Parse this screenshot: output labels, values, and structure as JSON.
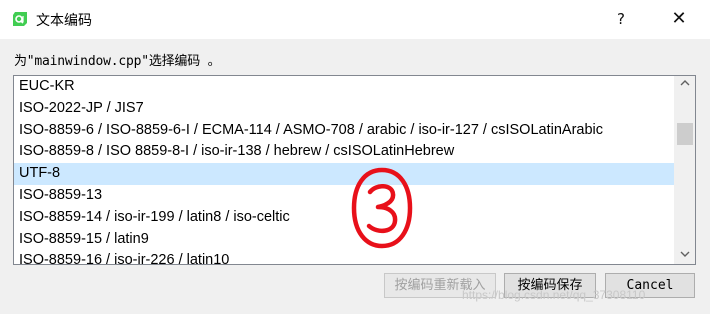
{
  "window": {
    "title": "文本编码",
    "help_label": "?",
    "close_label": "✕",
    "icon": "qt-logo-icon"
  },
  "prompt": "为\"mainwindow.cpp\"选择编码 。",
  "encodings": [
    "EUC-KR",
    "ISO-2022-JP / JIS7",
    "ISO-8859-6 / ISO-8859-6-I / ECMA-114 / ASMO-708 / arabic / iso-ir-127 / csISOLatinArabic",
    "ISO-8859-8 / ISO 8859-8-I / iso-ir-138 / hebrew / csISOLatinHebrew",
    "UTF-8",
    "ISO-8859-13",
    "ISO-8859-14 / iso-ir-199 / latin8 / iso-celtic",
    "ISO-8859-15 / latin9",
    "ISO-8859-16 / iso-ir-226 / latin10"
  ],
  "selected_encoding": "UTF-8",
  "annotation": "③",
  "buttons": {
    "reload": "按编码重新载入",
    "save": "按编码保存",
    "cancel": "Cancel"
  },
  "watermark": "https://blog.csdn.net/qq_37308110",
  "colors": {
    "selection": "#cce8ff",
    "annotation": "#e8101a",
    "qt_green": "#41cd52"
  }
}
